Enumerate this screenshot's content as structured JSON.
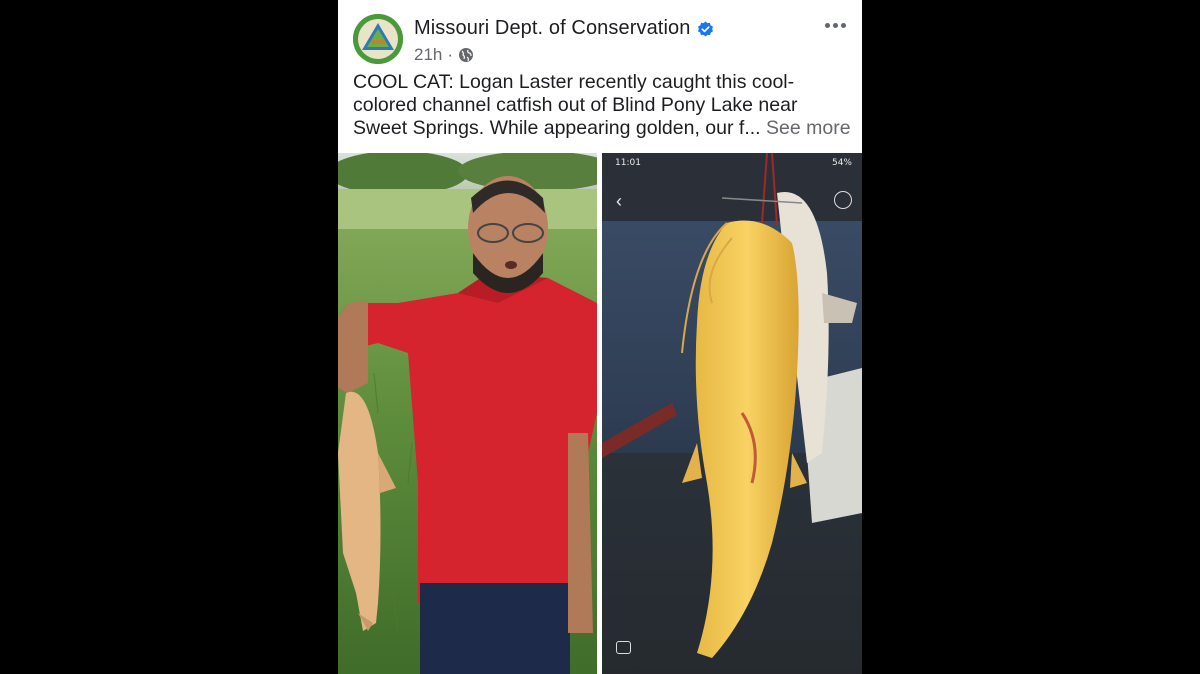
{
  "post": {
    "page_name": "Missouri Dept. of Conservation",
    "time": "21h",
    "separator": "·",
    "caption_lines": [
      "COOL CAT: Logan Laster recently caught this cool-",
      "colored channel catfish out of Blind Pony Lake near",
      "Sweet Springs. While appearing golden, our f..."
    ],
    "see_more": "See more"
  },
  "phone_screenshot": {
    "time": "11:01",
    "battery": "54%"
  },
  "colors": {
    "background": "#000000",
    "verified_blue": "#1877f2",
    "text_primary": "#1c1e21",
    "text_secondary": "#65676b"
  },
  "icons": [
    "verified-badge-icon",
    "globe-icon",
    "more-options-icon",
    "back-arrow-icon",
    "rotate-icon"
  ]
}
